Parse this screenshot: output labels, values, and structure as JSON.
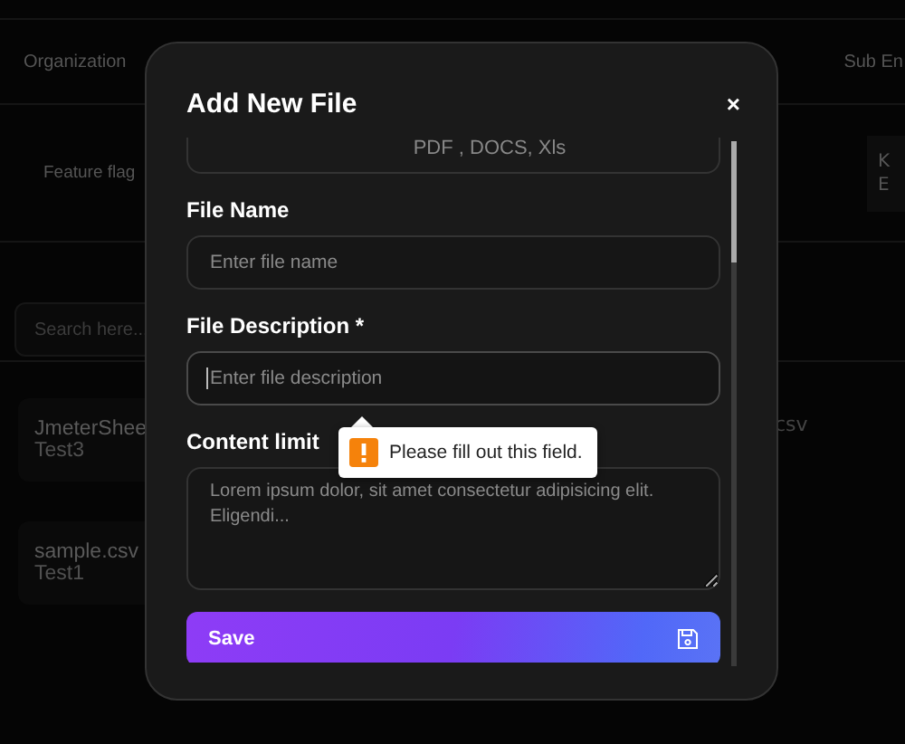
{
  "background": {
    "tabs": [
      {
        "label": "Organization"
      },
      {
        "label": "Sub En"
      }
    ],
    "feature_flags": "Feature flag",
    "side_card": [
      "K",
      "E"
    ],
    "search": {
      "placeholder": "Search here..."
    },
    "files": [
      {
        "name": "JmeterShee",
        "subtitle": "Test3"
      },
      {
        "name": "sample.csv",
        "subtitle": "Test1"
      }
    ],
    "other_card": "csv"
  },
  "dialog": {
    "title": "Add New File",
    "close": "×",
    "upload_hint": "PDF , DOCS, Xls",
    "fields": [
      {
        "kind": "input",
        "label": "File Name",
        "placeholder": "Enter file name",
        "focused": false
      },
      {
        "kind": "input",
        "label": "File Description *",
        "placeholder": "Enter file description",
        "focused": true
      },
      {
        "kind": "textarea",
        "label": "Content limit",
        "value": "Lorem ipsum dolor, sit amet consectetur adipisicing elit. Eligendi..."
      }
    ],
    "tooltip": "Please fill out this field.",
    "save": "Save"
  }
}
